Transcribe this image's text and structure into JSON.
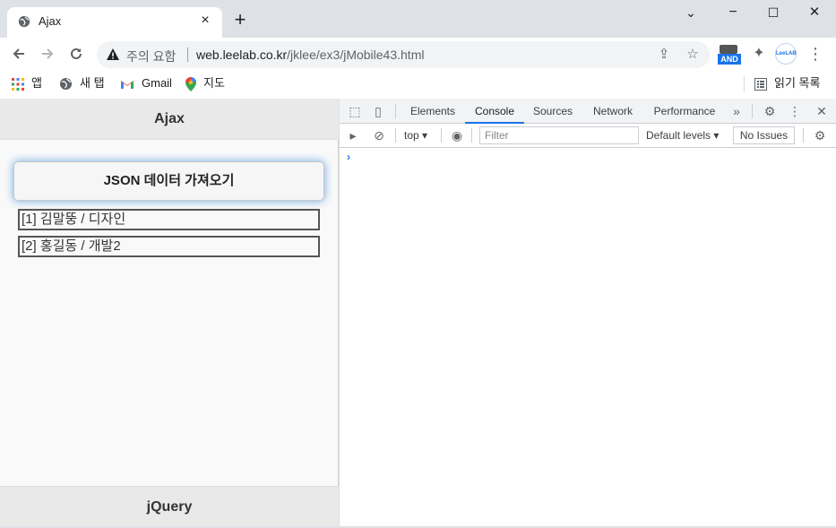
{
  "browser": {
    "tab_title": "Ajax",
    "close_label": "×",
    "new_tab_label": "+",
    "window_controls": {
      "minimize": "−",
      "maximize": "☐",
      "close": "✕",
      "tab_search": "⌄"
    }
  },
  "toolbar": {
    "security_text": "주의 요함",
    "url_host": "web.leelab.co.kr",
    "url_path": "/jklee/ex3/jMobile43.html",
    "ext_and_label": "AND",
    "ext_leelab_label": "LeeLAB"
  },
  "bookmarks": {
    "apps": "앱",
    "new_tab": "새 탭",
    "gmail": "Gmail",
    "maps": "지도",
    "reading_list": "읽기 목록"
  },
  "page": {
    "header": "Ajax",
    "button_label": "JSON 데이터 가져오기",
    "results": [
      "[1]  김말뚱 / 디자인",
      "[2]  홍길동 / 개발2"
    ],
    "footer": "jQuery"
  },
  "devtools": {
    "tabs": [
      "Elements",
      "Console",
      "Sources",
      "Network",
      "Performance"
    ],
    "active_tab": "Console",
    "more_tabs": "»",
    "context": "top",
    "filter_placeholder": "Filter",
    "levels": "Default levels",
    "issues": "No Issues",
    "prompt": "›"
  },
  "colors": {
    "accent": "#1a73e8",
    "button_glow": "#6aa7e5"
  }
}
